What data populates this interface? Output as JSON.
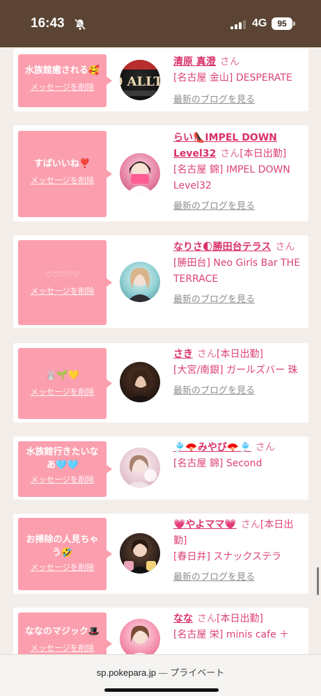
{
  "status": {
    "time": "16:43",
    "network": "4G",
    "battery": "95"
  },
  "url_bar": {
    "domain": "sp.pokepara.jp",
    "separator": " — ",
    "mode": "プライベート"
  },
  "san_label": "さん",
  "delete_label": "メッセージを削除",
  "blog_label": "最新のブログを見る",
  "cards": [
    {
      "message": "水族館癒される🥰",
      "name": "清原 真澄",
      "tag": "",
      "shop": "[名古屋 金山] DESPERATE",
      "avatar": "3000 ALLTIME"
    },
    {
      "message": "すばいいね❣️",
      "name": "らい👠IMPEL DOWN Level32",
      "tag": "[本日出勤]",
      "shop": "[名古屋 錦] IMPEL DOWN Level32",
      "avatar": ""
    },
    {
      "message": "♡♡♡♡♡",
      "name": "なりさ🌓勝田台テラス",
      "tag": "",
      "shop": "[勝田台] Neo Girls Bar THE TERRACE",
      "avatar": ""
    },
    {
      "message": "🐰🌱💛",
      "name": "さき",
      "tag": "[本日出勤]",
      "shop": "[大宮/南銀] ガールズバー 珠",
      "avatar": ""
    },
    {
      "message": "水族館行きたいなあ🩵🩵",
      "name": "🎐🪭みやび🪭🎐",
      "tag": "",
      "shop": "[名古屋 錦] Second",
      "avatar": ""
    },
    {
      "message": "お掃除の人見ちゃう🤣",
      "name": "💗やよママ💗",
      "tag": "[本日出勤]",
      "shop": "[春日井] スナックステラ",
      "avatar": ""
    },
    {
      "message": "ななのマジック🎩",
      "name": "なな",
      "tag": "[本日出勤]",
      "shop": "[名古屋 栄] minis cafe ＋",
      "avatar": ""
    }
  ],
  "colors": {
    "accent": "#d93066",
    "bubble": "#fb9fae",
    "header": "#5b4433"
  }
}
